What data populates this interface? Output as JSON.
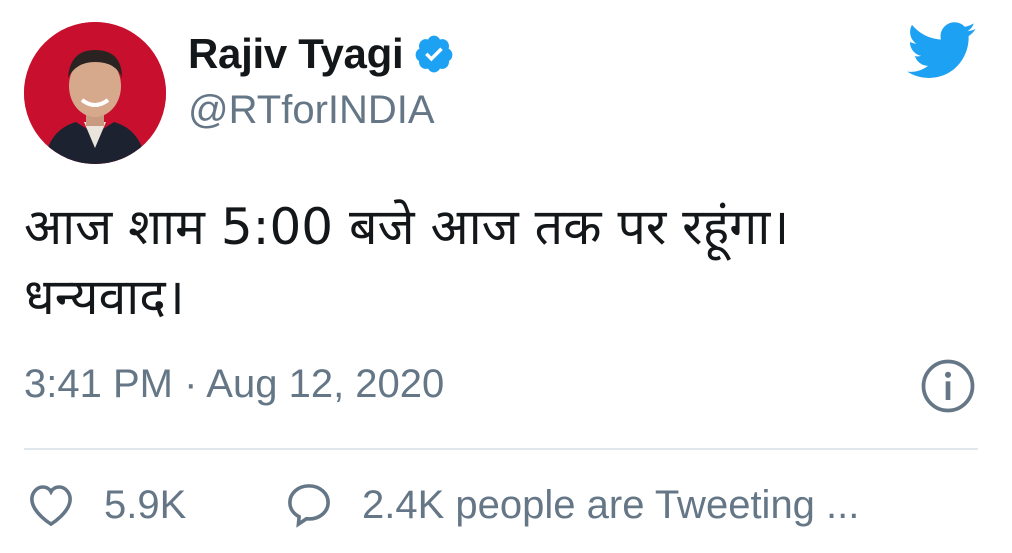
{
  "author": {
    "name": "Rajiv Tyagi",
    "handle": "@RTforINDIA",
    "verified_icon": "verified-badge-icon",
    "avatar_bg": "#c8102e"
  },
  "tweet": {
    "lines": [
      "आज शाम 5:00 बजे आज तक पर रहूंगा।",
      "धन्यवाद।"
    ],
    "timestamp": "3:41 PM · Aug 12, 2020"
  },
  "actions": {
    "likes": "5.9K",
    "conversation": "2.4K people are Tweeting ..."
  },
  "colors": {
    "accent": "#1da1f2",
    "secondary_text": "#657786",
    "divider": "#e1e8ed"
  }
}
